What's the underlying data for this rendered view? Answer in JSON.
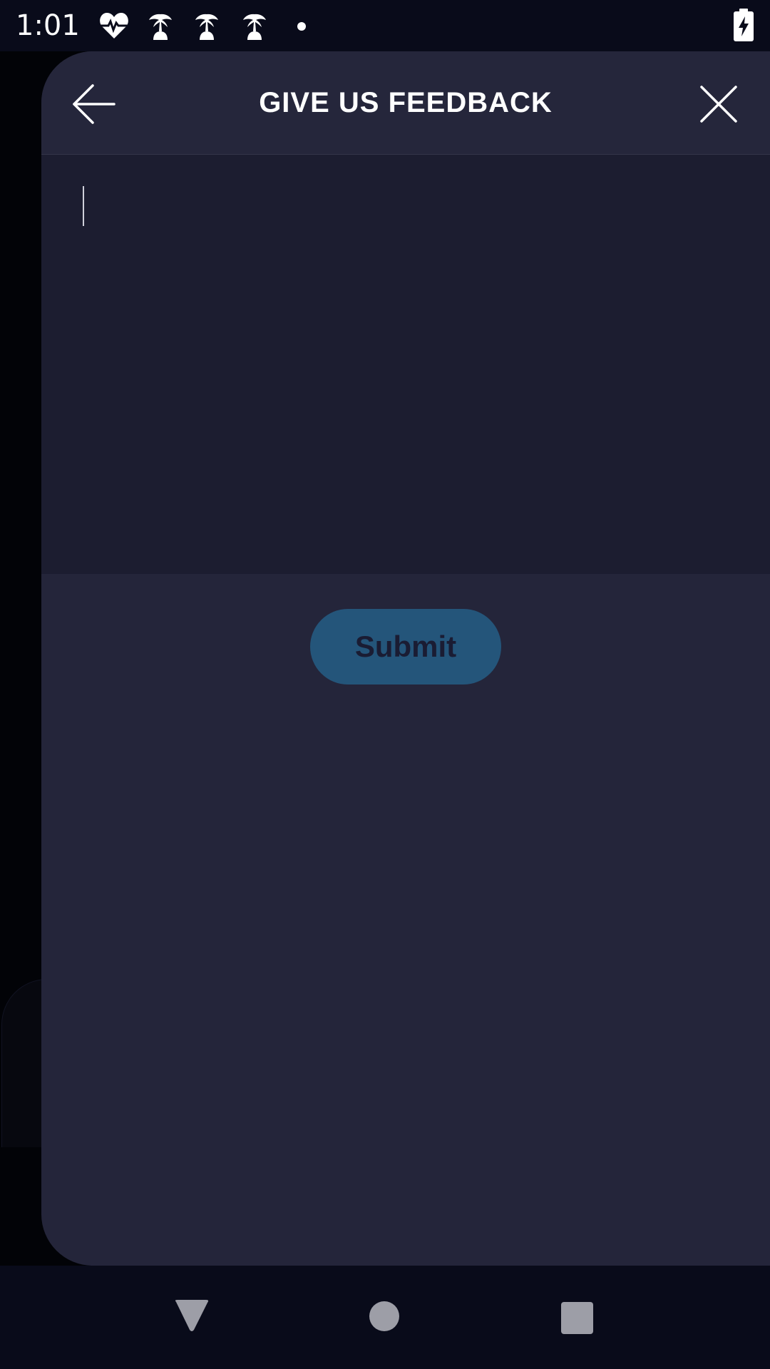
{
  "status_bar": {
    "time": "1:01",
    "icons": [
      "heart-pulse-icon",
      "palm-tree-icon",
      "palm-tree-icon",
      "palm-tree-icon",
      "notification-dot-icon",
      "battery-charging-icon"
    ]
  },
  "sheet": {
    "title": "GIVE US FEEDBACK",
    "back_icon": "arrow-left-icon",
    "close_icon": "close-icon",
    "feedback_input": {
      "value": "",
      "placeholder": ""
    },
    "submit_label": "Submit"
  },
  "nav_bar": {
    "icons": [
      "nav-back-icon",
      "nav-home-icon",
      "nav-recents-icon"
    ]
  },
  "colors": {
    "sheet_background": "#24253a",
    "input_background": "#1c1d30",
    "submit_background": "#24557a",
    "submit_text": "#1a1c33",
    "system_bar": "#090b1a",
    "nav_icon": "#9d9ea7"
  }
}
